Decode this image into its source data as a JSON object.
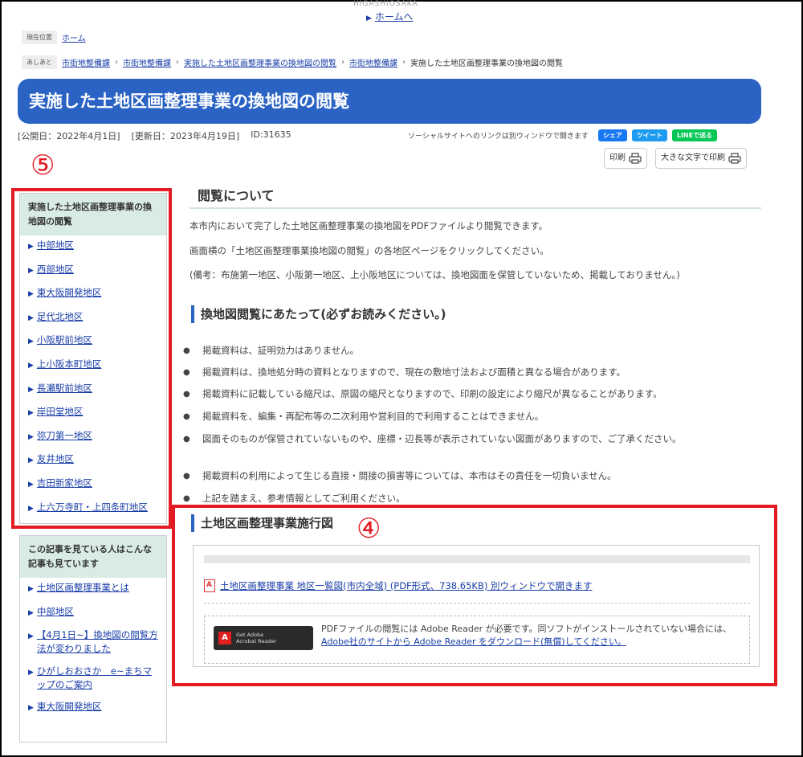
{
  "header": {
    "site_id": "HIGASHIOSAKA",
    "home_link": "ホームへ"
  },
  "location": {
    "tag": "現在位置",
    "home": "ホーム"
  },
  "breadcrumb": {
    "tag": "あしあと",
    "items": [
      "市街地整備課",
      "市街地整備課",
      "実施した土地区画整理事業の換地図の閲覧",
      "市街地整備課"
    ],
    "current": "実施した土地区画整理事業の換地図の閲覧"
  },
  "page": {
    "title": "実施した土地区画整理事業の換地図の閲覧",
    "published": "[公開日：2022年4月1日]",
    "updated": "[更新日：2023年4月19日]",
    "id": "ID:31635"
  },
  "social": {
    "note": "ソーシャルサイトへのリンクは別ウィンドウで開きます",
    "facebook": "シェア",
    "twitter": "ツイート",
    "line": "LINEで送る",
    "facebook_color": "#1877f2",
    "twitter_color": "#1d9bf0",
    "line_color": "#06c755"
  },
  "tools": {
    "print": "印刷",
    "print_large": "大きな文字で印刷",
    "print_icon": "printer-icon"
  },
  "annotations": {
    "marker_5": "⑤",
    "marker_4": "④",
    "highlight_color": "#e31b23"
  },
  "sidebar": {
    "heading": "実施した土地区画整理事業の換地図の閲覧",
    "items": [
      "中部地区",
      "西部地区",
      "東大阪開発地区",
      "足代北地区",
      "小阪駅前地区",
      "上小阪本町地区",
      "長瀬駅前地区",
      "岸田堂地区",
      "弥刀第一地区",
      "友井地区",
      "吉田新家地区",
      "上六万寺町・上四条町地区"
    ]
  },
  "related": {
    "heading": "この記事を見ている人はこんな記事も見ています",
    "items": [
      "土地区画整理事業とは",
      "中部地区",
      "【4月1日~】換地図の閲覧方法が変わりました",
      "ひがしおおさか　e~まちマップのご案内",
      "東大阪開発地区"
    ]
  },
  "main": {
    "section_title": "閲覧について",
    "intro1": "本市内において完了した土地区画整理事業の換地図をPDFファイルより閲覧できます。",
    "intro2": "画面横の「土地区画整理事業換地図の閲覧」の各地区ページをクリックしてください。",
    "note": "(備考：布施第一地区、小阪第一地区、上小阪地区については、換地図面を保管していないため、掲載しておりません。)",
    "notice_title": "換地図閲覧にあたって(必ずお読みください。)",
    "bullets": [
      "掲載資料は、証明効力はありません。",
      "掲載資料は、換地処分時の資料となりますので、現在の敷地寸法および面積と異なる場合があります。",
      "掲載資料に記載している縮尺は、原図の縮尺となりますので、印刷の設定により縮尺が異なることがあります。",
      "掲載資料を、編集・再配布等の二次利用や営利目的で利用することはできません。",
      "図面そのものが保管されていないものや、座標・辺長等が表示されていない図面がありますので、ご了承ください。",
      "掲載資料の利用によって生じる直接・間接の損害等については、本市はその責任を一切負いません。",
      "上記を踏まえ、参考情報としてご利用ください。"
    ],
    "pdf_section_title": "土地区画整理事業施行図",
    "pdf_link": "土地区画整理事業 地区一覧図(市内全域) (PDF形式、738.65KB) 別ウィンドウで開きます",
    "adobe_badge_line1": "Get Adobe",
    "adobe_badge_line2": "Acrobat Reader",
    "adobe_text": "PDFファイルの閲覧には Adobe Reader が必要です。同ソフトがインストールされていない場合には、",
    "adobe_link": "Adobe社のサイトから Adobe Reader をダウンロード(無償)してください。"
  }
}
